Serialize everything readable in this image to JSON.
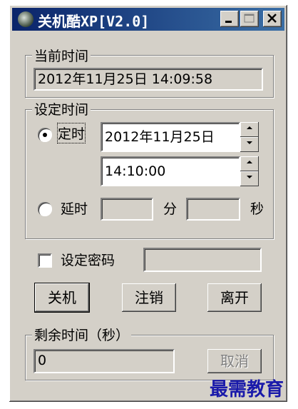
{
  "window": {
    "title": "关机酷XP[V2.0]"
  },
  "current_time": {
    "group_label": "当前时间",
    "value": "2012年11月25日     14:09:58"
  },
  "set_time": {
    "group_label": "设定时间",
    "scheduled_label": "定时",
    "scheduled_selected": true,
    "date_value": "2012年11月25日",
    "time_value": "14:10:00",
    "delay_label": "延时",
    "minutes_unit": "分",
    "seconds_unit": "秒",
    "delay_minutes_value": "",
    "delay_seconds_value": ""
  },
  "password": {
    "label": "设定密码",
    "checked": false,
    "value": ""
  },
  "buttons": {
    "shutdown": "关机",
    "logoff": "注销",
    "leave": "离开",
    "cancel": "取消"
  },
  "remaining": {
    "group_label": "剩余时间（秒）",
    "value": "0"
  },
  "watermark": "最需教育"
}
